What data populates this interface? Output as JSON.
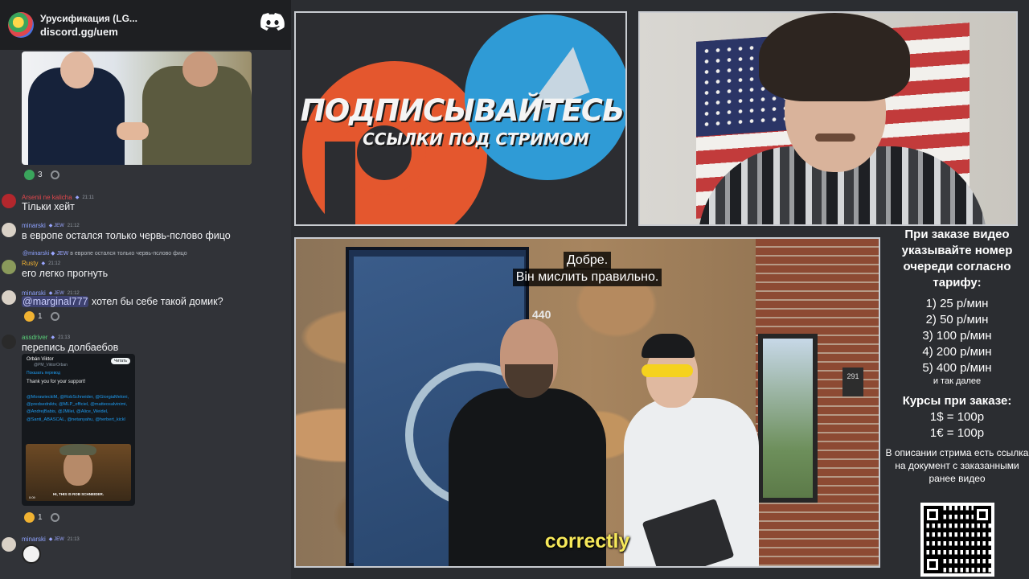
{
  "invite": {
    "title": "Урусификация (LG...",
    "link": "discord.gg/uem"
  },
  "chat": {
    "image_reactions": {
      "count": "3"
    },
    "messages": [
      {
        "user": "Arsenii ne kalicha",
        "badge": "",
        "time": "21:11",
        "text": "Тільки хейт",
        "user_color": "#e0474c"
      },
      {
        "user": "minarski",
        "badge": "JEW",
        "time": "21:12",
        "text": "в европе остался только червь-пслово фицо",
        "user_color": "#8ea2ff"
      },
      {
        "reply_user": "@minarski",
        "reply_badge": "JEW",
        "reply_text": "в европе остался только червь-пслово фицо",
        "user": "Rusty",
        "badge": "",
        "time": "21:12",
        "text": "его легко прогнуть",
        "user_color": "#f0b232"
      },
      {
        "user": "minarski",
        "badge": "JEW",
        "time": "21:12",
        "mention": "@marginal777",
        "text": "хотел бы себе такой домик?",
        "reaction_count": "1",
        "user_color": "#8ea2ff"
      },
      {
        "user": "assdriver",
        "badge": "",
        "time": "21:13",
        "text": "перепись долбаебов",
        "reaction_count": "1",
        "user_color": "#5ad17a"
      },
      {
        "user": "minarski",
        "badge": "JEW",
        "time": "21:13",
        "text": "",
        "user_color": "#8ea2ff"
      }
    ],
    "tweet": {
      "author": "Orbán Viktor",
      "handle": "@PM_ViktorOrban",
      "follow_label": "Читать",
      "translate_label": "Показать перевод",
      "body": "Thank you for your support!",
      "tags": "@MorawieckiM, @RobSchneider, @GiorgiaMeloni, @predsedniktv, @MLP_officiel, @matteosalvinimi, @AndrejBabis, @JMilei, @Alice_Weidel, @Santi_ABASCAL, @netanyahu, @herbert_kickl",
      "video_caption": "HI, THIS IS ROB SCHNEIDER.",
      "video_time": "0:09"
    }
  },
  "promo": {
    "title": "ПОДПИСЫВАЙТЕСЬ",
    "subtitle": "ССЫЛКИ ПОД СТРИМОМ"
  },
  "video": {
    "subtitle_line1": "Добре.",
    "subtitle_line2": "Він мислить правильно.",
    "caption": "correctly",
    "door_number": "440",
    "building_number": "291"
  },
  "info": {
    "heading": "При заказе видео указывайте номер очереди согласно тарифу:",
    "tariffs": [
      "1) 25 р/мин",
      "2) 50 р/мин",
      "3) 100 р/мин",
      "4) 200 р/мин",
      "5) 400 р/мин"
    ],
    "etc": "и так далее",
    "rates_heading": "Курсы при заказе:",
    "rates": [
      "1$ = 100р",
      "1€ = 100р"
    ],
    "description": "В описании стрима есть ссылка на документ с заказанными ранее видео"
  }
}
